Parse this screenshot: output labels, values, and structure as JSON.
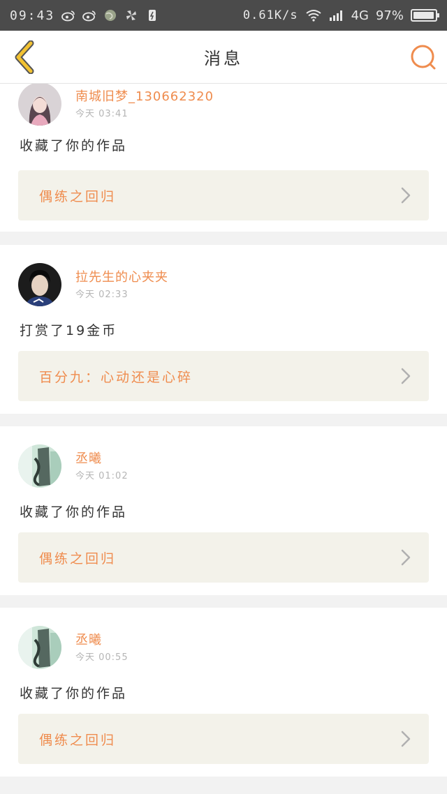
{
  "status_bar": {
    "time": "09:43",
    "net_speed": "0.61K/s",
    "network": "4G",
    "battery": "97%",
    "battery_level": 0.97,
    "icons": [
      "weibo-icon",
      "weibo-icon",
      "globe-icon",
      "pinwheel-icon",
      "notification-icon",
      "wifi-icon",
      "signal-icon",
      "battery-icon"
    ]
  },
  "nav": {
    "title": "消息",
    "back_icon": "chevron-left-icon",
    "search_icon": "search-icon"
  },
  "colors": {
    "accent": "#ef8c4e",
    "back_arrow": "#f2c232",
    "card_link_bg": "#f3f2ea",
    "page_bg": "#f2f2f2"
  },
  "messages": [
    {
      "user": "南城旧梦_130662320",
      "time": "今天 03:41",
      "action": "收藏了你的作品",
      "work": "偶练之回归",
      "avatar": "illustrated-girl-avatar"
    },
    {
      "user": "拉先生的心夹夹",
      "time": "今天 02:33",
      "action": "打赏了19金币",
      "work": "百分九：心动还是心碎",
      "avatar": "young-man-avatar"
    },
    {
      "user": "丞曦",
      "time": "今天 01:02",
      "action": "收藏了你的作品",
      "work": "偶练之回归",
      "avatar": "green-photo-avatar"
    },
    {
      "user": "丞曦",
      "time": "今天 00:55",
      "action": "收藏了你的作品",
      "work": "偶练之回归",
      "avatar": "green-photo-avatar"
    }
  ]
}
